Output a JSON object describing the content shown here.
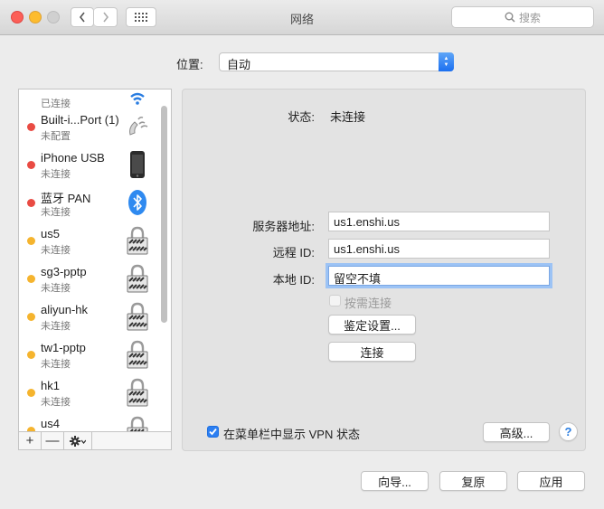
{
  "window": {
    "title": "网络",
    "search_placeholder": "搜索"
  },
  "location": {
    "label": "位置:",
    "value": "自动"
  },
  "services": [
    {
      "name": "",
      "status": "已连接",
      "dot_color": "",
      "icon": "wifi-icon"
    },
    {
      "name": "Built-i...Port (1)",
      "status": "未配置",
      "dot_color": "#e94b43",
      "icon": "phone-icon"
    },
    {
      "name": "iPhone USB",
      "status": "未连接",
      "dot_color": "#e94b43",
      "icon": "iphone-icon"
    },
    {
      "name": "蓝牙 PAN",
      "status": "未连接",
      "dot_color": "#e94b43",
      "icon": "bluetooth-icon"
    },
    {
      "name": "us5",
      "status": "未连接",
      "dot_color": "#f5b42e",
      "icon": "vpn-lock-icon"
    },
    {
      "name": "sg3-pptp",
      "status": "未连接",
      "dot_color": "#f5b42e",
      "icon": "vpn-lock-icon"
    },
    {
      "name": "aliyun-hk",
      "status": "未连接",
      "dot_color": "#f5b42e",
      "icon": "vpn-lock-icon"
    },
    {
      "name": "tw1-pptp",
      "status": "未连接",
      "dot_color": "#f5b42e",
      "icon": "vpn-lock-icon"
    },
    {
      "name": "hk1",
      "status": "未连接",
      "dot_color": "#f5b42e",
      "icon": "vpn-lock-icon"
    },
    {
      "name": "us4",
      "status": "",
      "dot_color": "#f5b42e",
      "icon": "vpn-lock-icon"
    }
  ],
  "sidebar_buttons": {
    "add": "+",
    "remove": "—"
  },
  "detail": {
    "status_label": "状态:",
    "status_value": "未连接",
    "server_label": "服务器地址:",
    "server_value": "us1.enshi.us",
    "remote_label": "远程 ID:",
    "remote_value": "us1.enshi.us",
    "local_label": "本地 ID:",
    "local_value": "留空不填",
    "on_demand_label": "按需连接",
    "on_demand_checked": false,
    "auth_button": "鉴定设置...",
    "connect_button": "连接",
    "show_vpn_label": "在菜单栏中显示 VPN 状态",
    "show_vpn_checked": true,
    "advanced_button": "高级...",
    "help_button": "?"
  },
  "footer": {
    "assist_button": "向导...",
    "revert_button": "复原",
    "apply_button": "应用"
  },
  "colors": {
    "accent": "#1b6ff0",
    "red_status": "#e94b43",
    "yellow_status": "#f5b42e"
  }
}
